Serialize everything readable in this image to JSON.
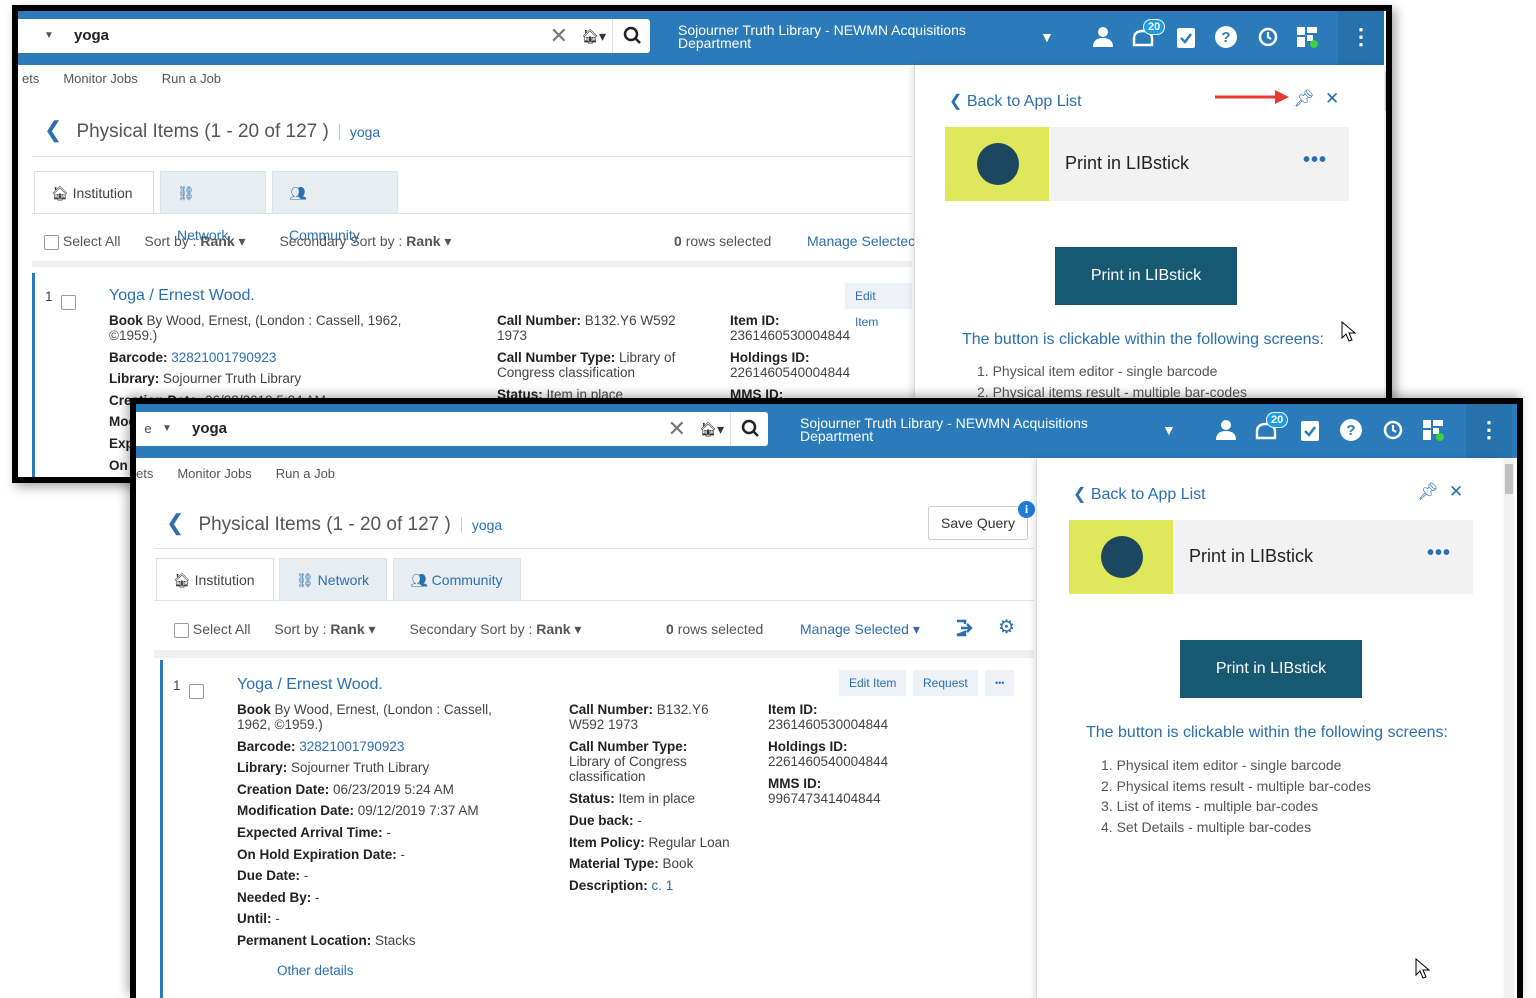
{
  "search": {
    "scope": "e",
    "query": "yoga"
  },
  "header": {
    "library_line1": "Sojourner Truth Library - NEWMN Acquisitions",
    "library_line2": "Department",
    "notification_count": "20"
  },
  "subnav": {
    "sets": "ets",
    "sets_front": "Sets",
    "monitor_jobs": "Monitor Jobs",
    "run_a_job": "Run a Job"
  },
  "results": {
    "title": "Physical Items (1 - 20 of 127 )",
    "query_tag": "yoga",
    "save_query": "Save Query",
    "tabs": [
      "Institution",
      "Network",
      "Community"
    ],
    "select_all": "Select All",
    "sort_by_label": "Sort by :",
    "sort_by_value": "Rank",
    "secondary_sort_label": "Secondary Sort by :",
    "secondary_sort_value": "Rank",
    "rows_selected_count": "0",
    "rows_selected_label": "rows selected",
    "manage_selected": "Manage Selected",
    "manage_selected_back": "Manage Selectec"
  },
  "item": {
    "index": "1",
    "title": "Yoga / Ernest Wood.",
    "edit_item": "Edit Item",
    "request": "Request",
    "more": "•••",
    "book_label": "Book",
    "book_value": "By Wood, Ernest, (London : Cassell, 1962, ©1959.)",
    "book_line1_front": "By Wood, Ernest, (London : Cassell,",
    "book_line2_front": "1962, ©1959.)",
    "book_line1_back": "By Wood, Ernest, (London : Cassell, 1962,",
    "book_line2_back": "©1959.)",
    "barcode_label": "Barcode:",
    "barcode_value": "32821001790923",
    "library_label": "Library:",
    "library_value": "Sojourner Truth Library",
    "creation_label": "Creation Date:",
    "creation_value": "06/23/2019 5:24 AM",
    "modification_label": "Modification Date:",
    "modification_value": "09/12/2019 7:37 AM",
    "expected_label": "Expected Arrival Time:",
    "expected_value": "-",
    "onhold_label": "On Hold Expiration Date:",
    "onhold_value": "-",
    "due_date_label": "Due Date:",
    "due_date_value": "-",
    "needed_label": "Needed By:",
    "needed_value": "-",
    "until_label": "Until:",
    "until_value": "-",
    "perm_loc_label": "Permanent Location:",
    "perm_loc_value": "Stacks",
    "other_details": "Other details",
    "call_number_label": "Call Number:",
    "call_number_value_front1": "B132.Y6",
    "call_number_value_front2": "W592 1973",
    "call_number_value_back1": "B132.Y6 W592",
    "call_number_value_back2": "1973",
    "call_type_label": "Call Number Type:",
    "call_type_front1": "Library of Congress",
    "call_type_front2": "classification",
    "call_type_back1": "Library of",
    "call_type_back2": "Congress classification",
    "status_label": "Status:",
    "status_value": "Item in place",
    "due_back_label": "Due back:",
    "due_back_value": "-",
    "policy_label": "Item Policy:",
    "policy_value": "Regular Loan",
    "material_label": "Material Type:",
    "material_value": "Book",
    "description_label": "Description:",
    "description_value": "c. 1",
    "item_id_label": "Item ID:",
    "item_id_value": "2361460530004844",
    "holdings_id_label": "Holdings ID:",
    "holdings_id_value": "2261460540004844",
    "mms_id_label": "MMS ID:",
    "mms_id_value": "996747341404844",
    "back_truncated_mod": "Moc",
    "back_truncated_exp": "Exp",
    "back_truncated_on": "On I"
  },
  "panel": {
    "back_to_app_list": "Back to App List",
    "app_name": "Print in LIBstick",
    "print_button": "Print in LIBstick",
    "clickable_text": "The button is clickable within the following",
    "clickable_link": "screens",
    "screens": [
      "1. Physical item editor - single barcode",
      "2. Physical items result - multiple bar-codes",
      "3. List of items - multiple bar-codes",
      "4. Set Details - multiple bar-codes"
    ]
  },
  "colors": {
    "header": "#2b7bba",
    "link": "#2b6fb0",
    "print_button": "#175873",
    "logo_bg": "#dfe75a",
    "annotation_arrow": "#e53935"
  },
  "icons": [
    "chevron-down-icon",
    "clear-icon",
    "home-icon",
    "search-icon",
    "user-icon",
    "notification-icon",
    "tasks-icon",
    "help-icon",
    "history-icon",
    "apps-icon",
    "kebab-icon",
    "back-icon",
    "pin-icon",
    "close-icon",
    "institution-icon",
    "network-icon",
    "community-icon",
    "export-icon",
    "settings-icon",
    "info-icon",
    "cursor-icon",
    "red-arrow-icon"
  ]
}
